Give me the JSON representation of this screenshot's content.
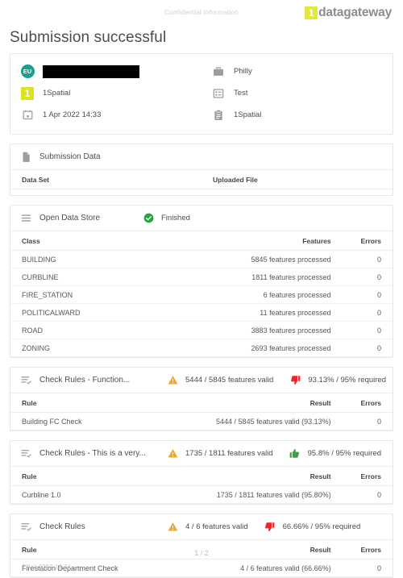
{
  "header": {
    "confidential": "Confidential Information",
    "brand_mark": "1",
    "brand_text": "datagateway"
  },
  "title": "Submission successful",
  "info": {
    "left": [
      {
        "icon": "eu-avatar-icon",
        "avatar_text": "EU",
        "label": "",
        "redacted": true
      },
      {
        "icon": "onespatial-logo-icon",
        "label": "1Spatial",
        "redacted": false
      },
      {
        "icon": "calendar-icon",
        "label": "1 Apr 2022 14:33",
        "redacted": false
      }
    ],
    "right": [
      {
        "icon": "briefcase-icon",
        "label": "Philly"
      },
      {
        "icon": "list-card-icon",
        "label": "Test"
      },
      {
        "icon": "clipboard-icon",
        "label": "1Spatial"
      }
    ]
  },
  "submission_data": {
    "icon": "document-icon",
    "title": "Submission Data",
    "columns": [
      "Data Set",
      "Uploaded File"
    ],
    "rows": []
  },
  "open_data_store": {
    "icon": "list-lines-icon",
    "title": "Open Data Store",
    "status_icon": "check-circle-icon",
    "status": "Finished",
    "columns": [
      "Class",
      "Features",
      "Errors"
    ],
    "rows": [
      {
        "class": "BUILDING",
        "features": "5845 features processed",
        "errors": "0"
      },
      {
        "class": "CURBLINE",
        "features": "1811 features processed",
        "errors": "0"
      },
      {
        "class": "FIRE_STATION",
        "features": "6 features processed",
        "errors": "0"
      },
      {
        "class": "POLITICALWARD",
        "features": "11 features processed",
        "errors": "0"
      },
      {
        "class": "ROAD",
        "features": "3883 features processed",
        "errors": "0"
      },
      {
        "class": "ZONING",
        "features": "2693 features processed",
        "errors": "0"
      }
    ]
  },
  "check_sections": [
    {
      "icon": "rules-check-icon",
      "title": "Check Rules - Function...",
      "warn_icon": "warning-triangle-icon",
      "valid_text": "5444 / 5845 features valid",
      "verdict_icon": "thumbs-down-icon",
      "verdict": "fail",
      "required_text": "93.13% / 95% required",
      "columns": [
        "Rule",
        "Result",
        "Errors"
      ],
      "rows": [
        {
          "rule": "Building FC Check",
          "result": "5444 / 5845 features valid (93.13%)",
          "errors": "0"
        }
      ]
    },
    {
      "icon": "rules-check-icon",
      "title": "Check Rules - This is a very...",
      "warn_icon": "warning-triangle-icon",
      "valid_text": "1735 / 1811 features valid",
      "verdict_icon": "thumbs-up-icon",
      "verdict": "pass",
      "required_text": "95.8% / 95% required",
      "columns": [
        "Rule",
        "Result",
        "Errors"
      ],
      "rows": [
        {
          "rule": "Curbline 1.0",
          "result": "1735 / 1811 features valid (95.80%)",
          "errors": "0"
        }
      ]
    },
    {
      "icon": "rules-check-icon",
      "title": "Check Rules",
      "warn_icon": "warning-triangle-icon",
      "valid_text": "4 / 6 features valid",
      "verdict_icon": "thumbs-down-icon",
      "verdict": "fail",
      "required_text": "66.66% / 95% required",
      "columns": [
        "Rule",
        "Result",
        "Errors"
      ],
      "rows": [
        {
          "rule": "Firestation Department Check",
          "result": "4 / 6 features valid (66.66%)",
          "errors": "0"
        }
      ]
    }
  ],
  "footer": {
    "pager": "1 / 2",
    "date": "1 Apr 2022 14:34"
  },
  "colors": {
    "brand_yellow": "#dfe93f",
    "avatar_teal": "#17a08c",
    "warning_orange": "#f5a623",
    "fail_red": "#e8262c",
    "pass_green": "#38a03c",
    "success_green": "#22a63a",
    "icon_gray": "#9a9da1",
    "text": "#44474a"
  }
}
